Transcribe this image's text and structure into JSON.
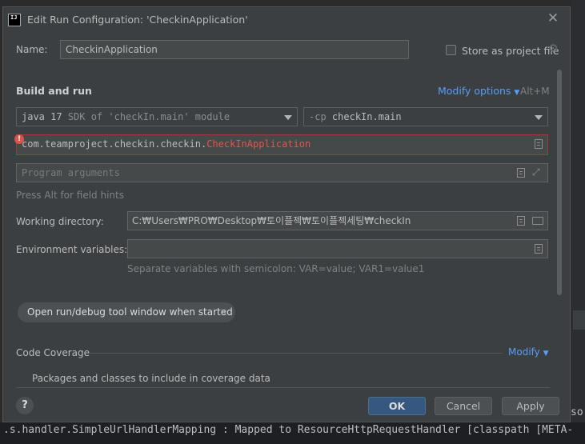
{
  "background": {
    "log_line": ".s.handler.SimpleUrlHandlerMapping  : Mapped to ResourceHttpRequestHandler [classpath [META-",
    "right_text": "so"
  },
  "dialog": {
    "title": "Edit Run Configuration: 'CheckinApplication'",
    "app_icon_text": "IJ",
    "name_label": "Name:",
    "name_value": "CheckinApplication",
    "store_label": "Store as project file",
    "build_run_title": "Build and run",
    "modify_options": "Modify options",
    "modify_shortcut": "Alt+M",
    "jdk_bold": "java 17",
    "jdk_detail": "SDK of 'checkIn.main' module",
    "cp_prefix": "-cp",
    "cp_value": "checkIn.main",
    "main_class_package": "com.teamproject.checkin.checkin.",
    "main_class_name": "CheckInApplication",
    "program_args_placeholder": "Program arguments",
    "field_hint": "Press Alt for field hints",
    "working_dir_label": "Working directory:",
    "working_dir_value": "C:₩Users₩PRO₩Desktop₩토이플젝₩토이플젝세팅₩checkIn",
    "env_label": "Environment variables:",
    "env_hint": "Separate variables with semicolon: VAR=value; VAR1=value1",
    "chip_label": "Open run/debug tool window when started",
    "code_coverage": "Code Coverage",
    "modify": "Modify",
    "packages_label": "Packages and classes to include in coverage data",
    "help": "?",
    "ok": "OK",
    "cancel": "Cancel",
    "apply": "Apply"
  },
  "colors": {
    "accent": "#589df6",
    "error": "#e5534b",
    "ok_button": "#365880"
  }
}
